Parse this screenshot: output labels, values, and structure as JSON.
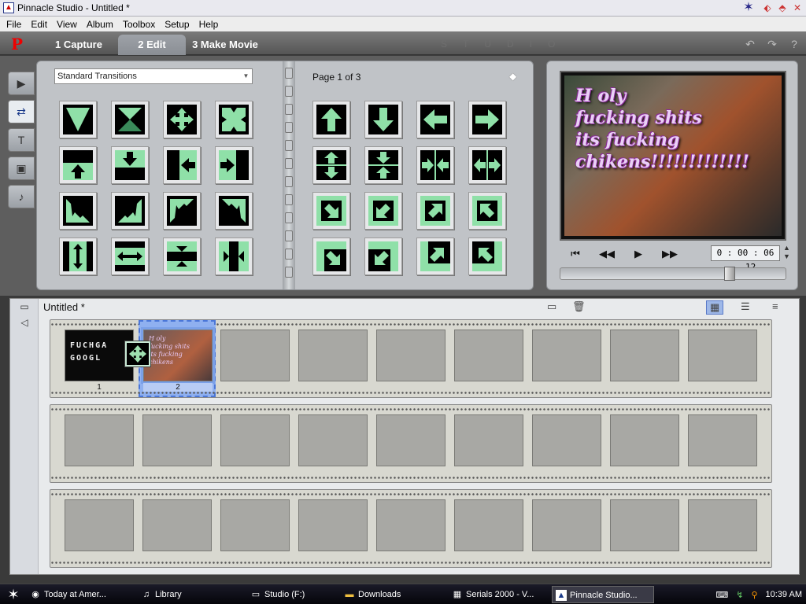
{
  "window": {
    "title": "Pinnacle Studio - Untitled *",
    "controls": [
      "✶",
      "⬖",
      "⬘",
      "✕"
    ]
  },
  "menu": [
    "File",
    "Edit",
    "View",
    "Album",
    "Toolbox",
    "Setup",
    "Help"
  ],
  "tabs": {
    "logo": "P",
    "capture": "1 Capture",
    "edit": "2 Edit",
    "make_movie": "3 Make Movie",
    "brand": "STUDIO"
  },
  "sidetabs": [
    {
      "icon": "video-camera-icon",
      "glyph": "🎥"
    },
    {
      "icon": "transitions-icon",
      "glyph": "⇄"
    },
    {
      "icon": "title-icon",
      "glyph": "T"
    },
    {
      "icon": "photo-icon",
      "glyph": "▣"
    },
    {
      "icon": "sound-effects-icon",
      "glyph": "🔊"
    }
  ],
  "album": {
    "dropdown_value": "Standard Transitions",
    "page_label": "Page 1 of 3"
  },
  "preview": {
    "caption_lines": [
      "H oly",
      "fucking shits",
      "its fucking",
      "chikens!!!!!!!!!!!!!"
    ],
    "timecode": "0 : 00 : 06 . 12",
    "scrub_position": 0.76
  },
  "storyboard": {
    "title": "Untitled *",
    "clips": [
      {
        "label": "1",
        "text_lines": [
          "FUCHGA",
          "GOOGL"
        ]
      },
      {
        "label": "2",
        "text_lines": [
          "H oly",
          "fucking shits",
          "its fucking",
          "chikens"
        ]
      }
    ]
  },
  "taskbar": {
    "items": [
      {
        "label": "Today at Amer...",
        "icon": "globe-icon"
      },
      {
        "label": "Library",
        "icon": "library-icon"
      },
      {
        "label": "Studio (F:)",
        "icon": "drive-icon"
      },
      {
        "label": "Downloads",
        "icon": "folder-icon"
      },
      {
        "label": "Serials 2000 - V...",
        "icon": "serials-icon"
      },
      {
        "label": "Pinnacle Studio...",
        "icon": "pinnacle-icon"
      }
    ],
    "clock": "10:39 AM"
  }
}
